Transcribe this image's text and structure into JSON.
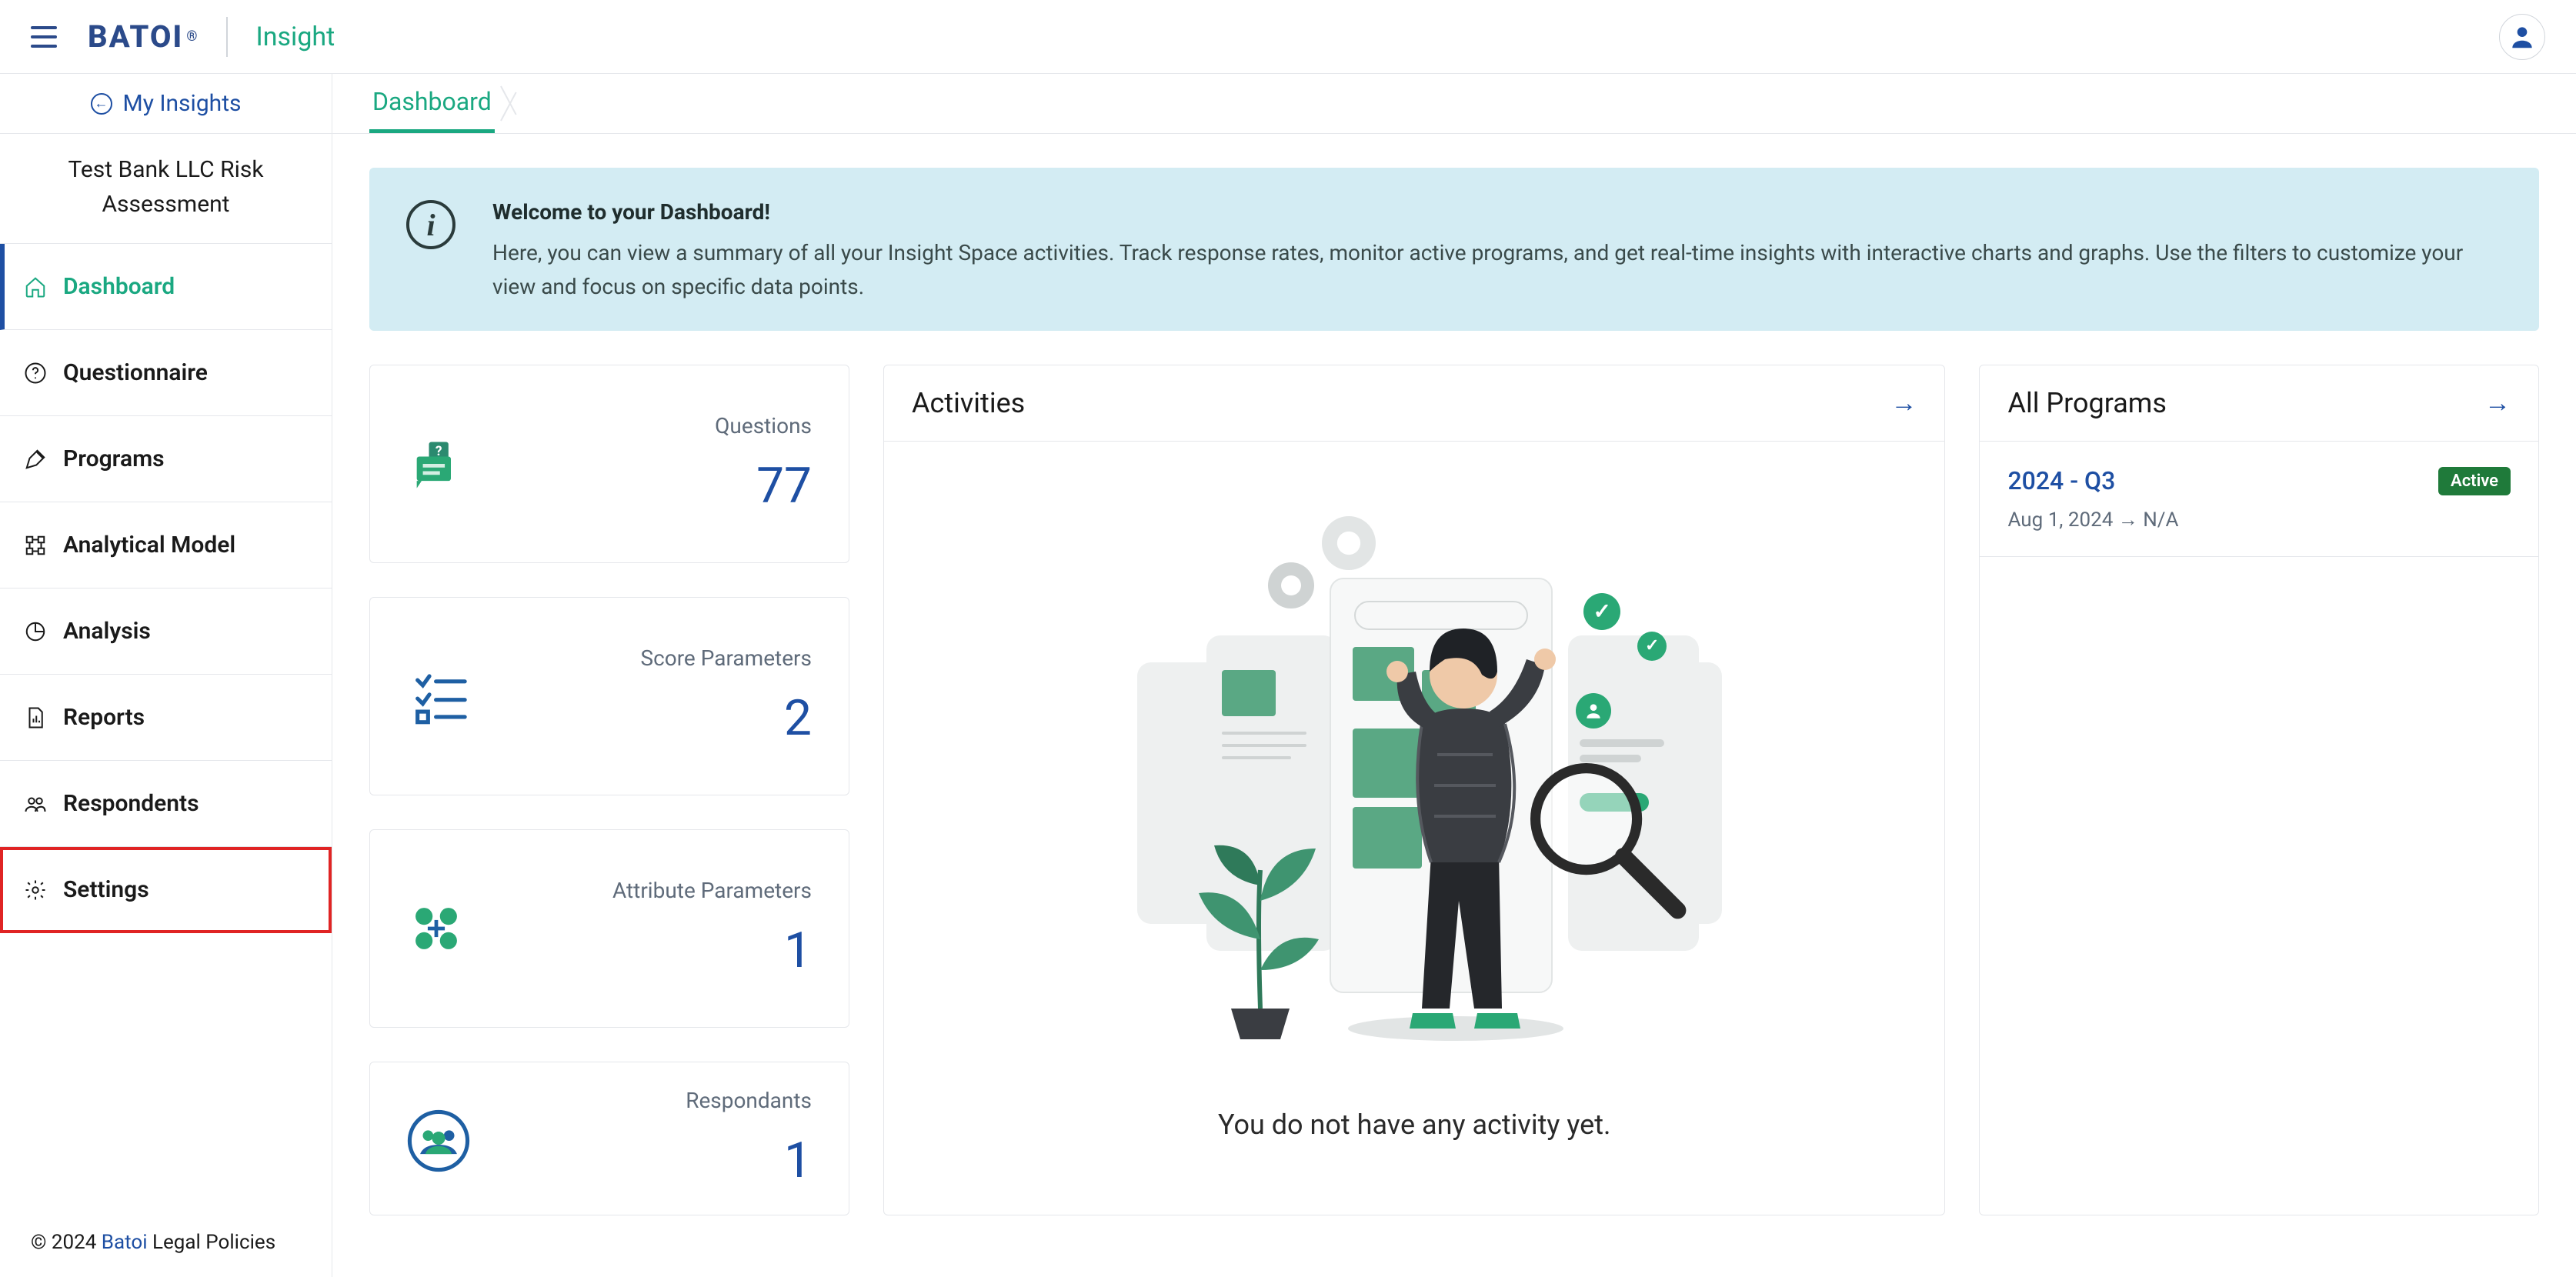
{
  "header": {
    "logo_text": "BATOI",
    "app_name": "Insight"
  },
  "sidebar": {
    "back_label": "My Insights",
    "project_title": "Test Bank LLC Risk Assessment",
    "items": [
      {
        "label": "Dashboard"
      },
      {
        "label": "Questionnaire"
      },
      {
        "label": "Programs"
      },
      {
        "label": "Analytical Model"
      },
      {
        "label": "Analysis"
      },
      {
        "label": "Reports"
      },
      {
        "label": "Respondents"
      },
      {
        "label": "Settings"
      }
    ],
    "footer_prefix": "© 2024 ",
    "footer_link": "Batoi",
    "footer_suffix": " Legal Policies"
  },
  "breadcrumb": {
    "current": "Dashboard"
  },
  "banner": {
    "title": "Welcome to your Dashboard!",
    "body": "Here, you can view a summary of all your Insight Space activities. Track response rates, monitor active programs, and get real-time insights with interactive charts and graphs. Use the filters to customize your view and focus on specific data points."
  },
  "stats": {
    "questions": {
      "label": "Questions",
      "value": "77"
    },
    "score": {
      "label": "Score Parameters",
      "value": "2"
    },
    "attribute": {
      "label": "Attribute Parameters",
      "value": "1"
    },
    "respondants": {
      "label": "Respondants",
      "value": "1"
    }
  },
  "activities": {
    "title": "Activities",
    "empty_text": "You do not have any activity yet."
  },
  "programs": {
    "title": "All Programs",
    "items": [
      {
        "name": "2024 - Q3",
        "status": "Active",
        "date_start": "Aug 1, 2024",
        "date_arrow": "→",
        "date_end": "N/A"
      }
    ]
  }
}
